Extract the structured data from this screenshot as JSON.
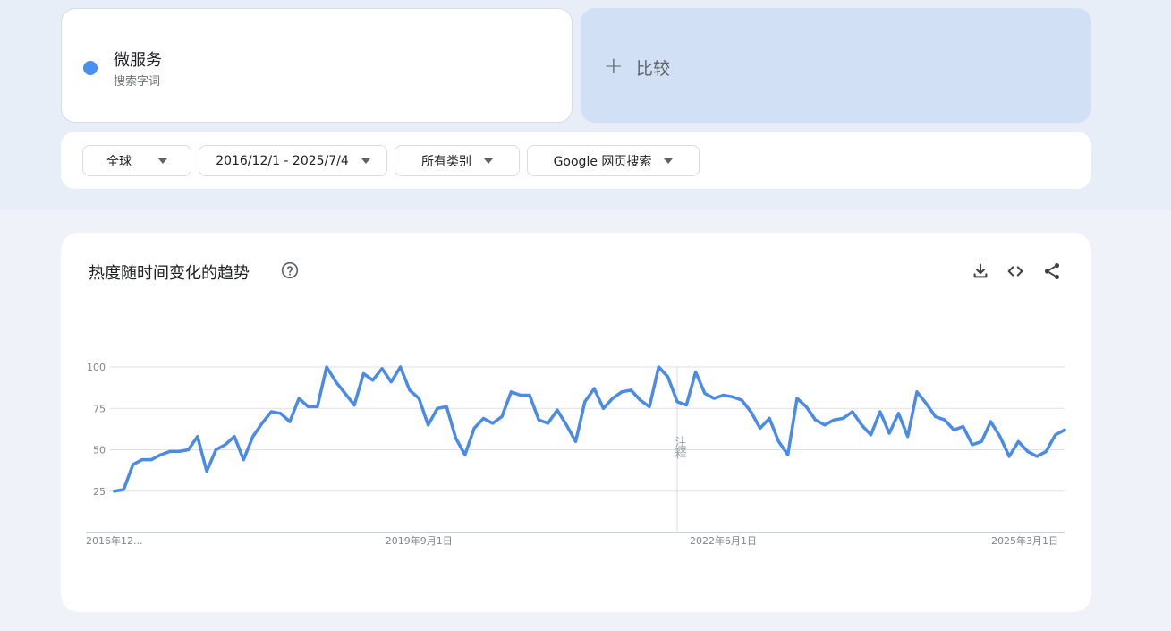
{
  "search_term": {
    "name": "微服务",
    "type_label": "搜索字词",
    "color": "#4a90f2"
  },
  "compare": {
    "plus": "+",
    "label": "比较"
  },
  "filters": [
    {
      "label": "全球"
    },
    {
      "label": "2016/12/1 - 2025/7/4"
    },
    {
      "label": "所有类别"
    },
    {
      "label": "Google 网页搜索"
    }
  ],
  "chart_card": {
    "title": "热度随时间变化的趋势",
    "help_icon": "help-circle-icon",
    "actions": [
      "download-icon",
      "embed-code-icon",
      "share-icon"
    ]
  },
  "chart_data": {
    "type": "line",
    "title": "热度随时间变化的趋势",
    "ylim": [
      0,
      100
    ],
    "yticks": [
      25,
      50,
      75,
      100
    ],
    "grid": true,
    "x_start": "2016-12",
    "x_frequency": "monthly",
    "xtick_labels": [
      {
        "label": "2016年12...",
        "date": "2016-12-01"
      },
      {
        "label": "2019年9月1日",
        "date": "2019-09-01"
      },
      {
        "label": "2022年6月1日",
        "date": "2022-06-01"
      },
      {
        "label": "2025年3月1日",
        "date": "2025-03-01"
      }
    ],
    "annotation": {
      "text": "注释",
      "date": "2022-01-01"
    },
    "line_color": "#4a8ae8",
    "series": [
      {
        "values": [
          25,
          26,
          41,
          44,
          44,
          47,
          49,
          49,
          50,
          58,
          37,
          50,
          53,
          58,
          44,
          58,
          66,
          73,
          72,
          67,
          81,
          76,
          76,
          100,
          91,
          84,
          77,
          96,
          92,
          99,
          91,
          100,
          86,
          81,
          65,
          75,
          76,
          57,
          47,
          63,
          69,
          66,
          70,
          85,
          83,
          83,
          68,
          66,
          74,
          65,
          55,
          79,
          87,
          75,
          81,
          85,
          86,
          80,
          76,
          100,
          94,
          79,
          77,
          97,
          84,
          81,
          83,
          82,
          80,
          73,
          63,
          69,
          55,
          47,
          81,
          76,
          68,
          65,
          68,
          69,
          73,
          65,
          59,
          73,
          60,
          72,
          58,
          85,
          78,
          70,
          68,
          62,
          64,
          53,
          55,
          67,
          58,
          46,
          55,
          49,
          46,
          49,
          59,
          62
        ]
      }
    ]
  }
}
